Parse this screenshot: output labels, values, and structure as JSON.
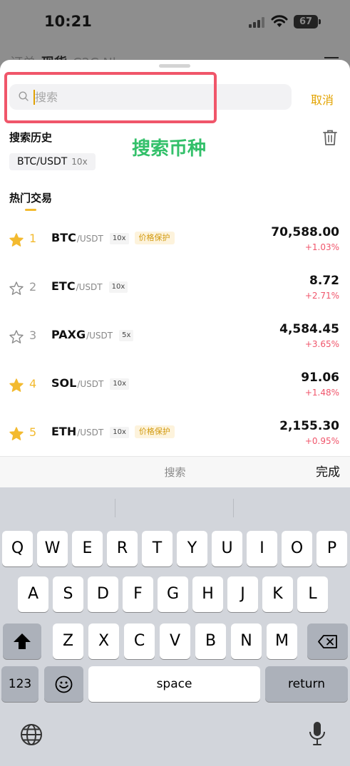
{
  "status": {
    "time": "10:21",
    "battery": "67"
  },
  "background": {
    "tabs": [
      "订单",
      "现货",
      "C2C",
      "Nl"
    ]
  },
  "search": {
    "placeholder": "搜索",
    "value": "",
    "cancel_label": "取消"
  },
  "annotation_text": "搜索币种",
  "history": {
    "title": "搜索历史",
    "items": [
      {
        "pair": "BTC/USDT",
        "leverage": "10x"
      }
    ]
  },
  "hot": {
    "title": "热门交易",
    "items": [
      {
        "rank": "1",
        "starred": true,
        "symbol": "BTC",
        "quote": "/USDT",
        "leverage": "10x",
        "badge": "价格保护",
        "price": "70,588.00",
        "change": "+1.03%"
      },
      {
        "rank": "2",
        "starred": false,
        "symbol": "ETC",
        "quote": "/USDT",
        "leverage": "10x",
        "badge": "",
        "price": "8.72",
        "change": "+2.71%"
      },
      {
        "rank": "3",
        "starred": false,
        "symbol": "PAXG",
        "quote": "/USDT",
        "leverage": "5x",
        "badge": "",
        "price": "4,584.45",
        "change": "+3.65%"
      },
      {
        "rank": "4",
        "starred": true,
        "symbol": "SOL",
        "quote": "/USDT",
        "leverage": "10x",
        "badge": "",
        "price": "91.06",
        "change": "+1.48%"
      },
      {
        "rank": "5",
        "starred": true,
        "symbol": "ETH",
        "quote": "/USDT",
        "leverage": "10x",
        "badge": "价格保护",
        "price": "2,155.30",
        "change": "+0.95%"
      }
    ]
  },
  "accessory": {
    "title": "搜索",
    "done_label": "完成"
  },
  "keyboard": {
    "row1": [
      "Q",
      "W",
      "E",
      "R",
      "T",
      "Y",
      "U",
      "I",
      "O",
      "P"
    ],
    "row2": [
      "A",
      "S",
      "D",
      "F",
      "G",
      "H",
      "J",
      "K",
      "L"
    ],
    "row3": [
      "Z",
      "X",
      "C",
      "V",
      "B",
      "N",
      "M"
    ],
    "numbers_label": "123",
    "space_label": "space",
    "return_label": "return"
  },
  "colors": {
    "accent": "#e3a300",
    "up": "#f0556b",
    "star": "#f3ba2f",
    "annotation": "#33c06a",
    "highlight": "#f0566a"
  }
}
